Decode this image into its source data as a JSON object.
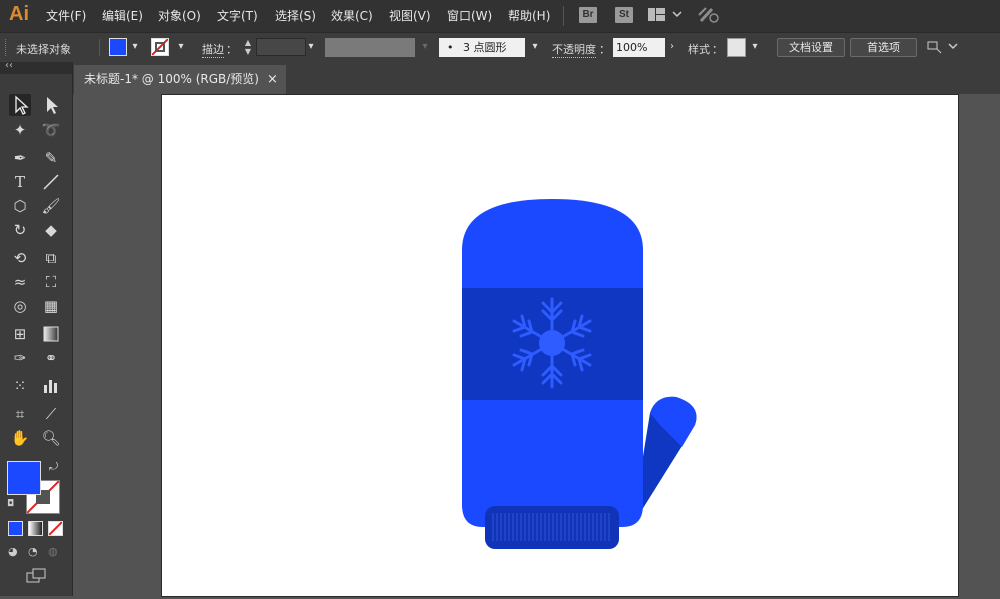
{
  "app": {
    "logo": "Ai"
  },
  "menu": [
    {
      "id": "file",
      "label": "文件(F)"
    },
    {
      "id": "edit",
      "label": "编辑(E)"
    },
    {
      "id": "object",
      "label": "对象(O)"
    },
    {
      "id": "type",
      "label": "文字(T)"
    },
    {
      "id": "select",
      "label": "选择(S)"
    },
    {
      "id": "effect",
      "label": "效果(C)"
    },
    {
      "id": "view",
      "label": "视图(V)"
    },
    {
      "id": "window",
      "label": "窗口(W)"
    },
    {
      "id": "help",
      "label": "帮助(H)"
    }
  ],
  "menu_icons": {
    "bridge": "Br",
    "stock": "St"
  },
  "control": {
    "selection_status": "未选择对象",
    "fill_color": "#1a49ff",
    "stroke_label": "描边",
    "colon": "：",
    "brush_label": "3 点圆形",
    "brush_dot": "•",
    "opacity_label": "不透明度",
    "opacity_value": "100%",
    "style_label": "样式",
    "doc_setup_button": "文档设置",
    "preferences_button": "首选项"
  },
  "tabs": [
    {
      "title": "未标题-1* @ 100% (RGB/预览)",
      "close": "×"
    }
  ],
  "tools": {
    "collapse_label": "‹‹",
    "fill_color": "#1a49ff",
    "stroke_color": "none"
  },
  "colors": {
    "mitten": "#1a49ff",
    "mitten_band": "#0f37c2",
    "snowflake": "#2f5cff",
    "cuff": "#1033b8"
  }
}
